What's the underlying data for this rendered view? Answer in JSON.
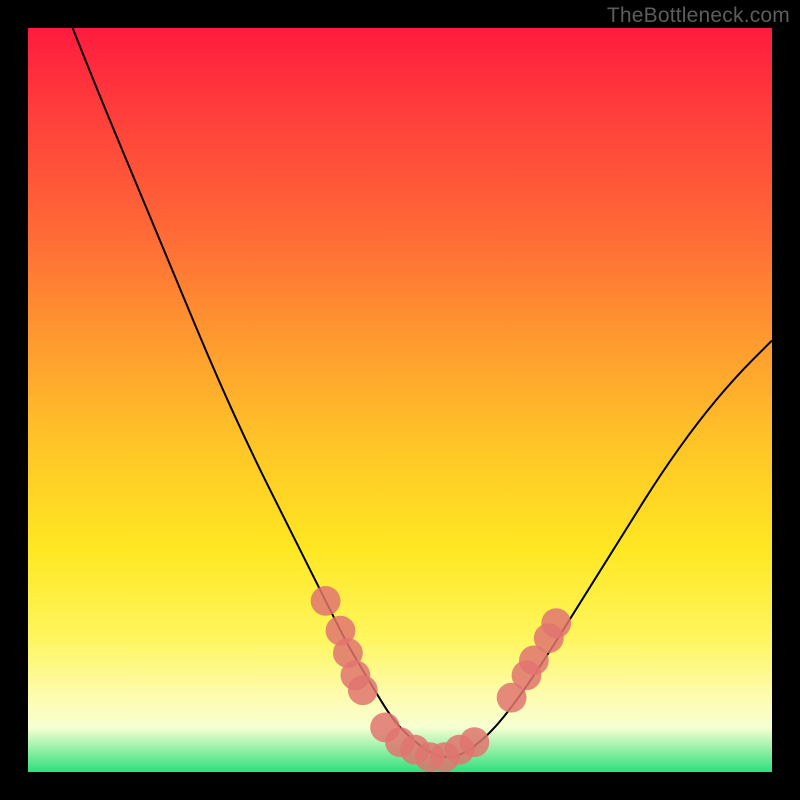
{
  "watermark": "TheBottleneck.com",
  "chart_data": {
    "type": "line",
    "title": "",
    "xlabel": "",
    "ylabel": "",
    "xlim": [
      0,
      100
    ],
    "ylim": [
      0,
      100
    ],
    "grid": false,
    "legend": false,
    "background_gradient": {
      "direction": "vertical",
      "stops": [
        {
          "pos": 0.0,
          "color": "#ff1b3e"
        },
        {
          "pos": 0.1,
          "color": "#ff3a3c"
        },
        {
          "pos": 0.28,
          "color": "#ff6b36"
        },
        {
          "pos": 0.42,
          "color": "#ff9a2f"
        },
        {
          "pos": 0.56,
          "color": "#ffc527"
        },
        {
          "pos": 0.7,
          "color": "#ffe722"
        },
        {
          "pos": 0.82,
          "color": "#fff65e"
        },
        {
          "pos": 0.9,
          "color": "#fdfcb0"
        },
        {
          "pos": 0.94,
          "color": "#f7ffd2"
        },
        {
          "pos": 1.0,
          "color": "#2fe07b"
        }
      ]
    },
    "series": [
      {
        "name": "bottleneck-curve",
        "color": "#000000",
        "x": [
          6,
          10,
          15,
          20,
          25,
          30,
          35,
          40,
          43,
          46,
          49,
          52,
          55,
          58,
          62,
          66,
          70,
          75,
          80,
          85,
          90,
          95,
          100
        ],
        "y": [
          100,
          90,
          78,
          66,
          54,
          43,
          33,
          23,
          17,
          12,
          7,
          4,
          2,
          2,
          5,
          10,
          16,
          24,
          32,
          40,
          47,
          53,
          58
        ]
      }
    ],
    "markers": {
      "name": "highlighted-points",
      "color": "#e07470",
      "radius": 2.0,
      "points": [
        {
          "x": 40,
          "y": 23
        },
        {
          "x": 42,
          "y": 19
        },
        {
          "x": 43,
          "y": 16
        },
        {
          "x": 44,
          "y": 13
        },
        {
          "x": 45,
          "y": 11
        },
        {
          "x": 48,
          "y": 6
        },
        {
          "x": 50,
          "y": 4
        },
        {
          "x": 52,
          "y": 3
        },
        {
          "x": 54,
          "y": 2
        },
        {
          "x": 56,
          "y": 2
        },
        {
          "x": 58,
          "y": 3
        },
        {
          "x": 60,
          "y": 4
        },
        {
          "x": 65,
          "y": 10
        },
        {
          "x": 67,
          "y": 13
        },
        {
          "x": 68,
          "y": 15
        },
        {
          "x": 70,
          "y": 18
        },
        {
          "x": 71,
          "y": 20
        }
      ]
    }
  }
}
